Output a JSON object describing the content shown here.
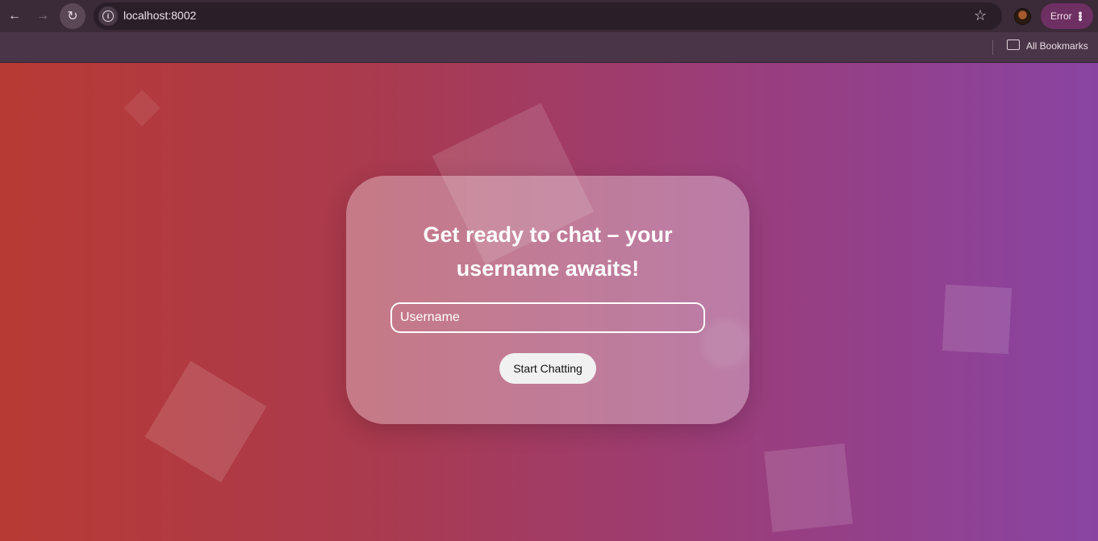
{
  "browser": {
    "url": "localhost:8002",
    "profile_button": "Error",
    "bookmarks_label": "All Bookmarks",
    "icons": [
      "back-icon",
      "forward-icon",
      "reload-icon",
      "site-info-icon",
      "star-icon",
      "profile-avatar",
      "more-icon",
      "folder-icon"
    ]
  },
  "page": {
    "title": "Get ready to chat – your username awaits!",
    "username_placeholder": "Username",
    "start_button": "Start Chatting",
    "colors": {
      "gradient_start": "#b83a34",
      "gradient_end": "#8944a3",
      "button_bg": "#f1f1f1"
    }
  }
}
